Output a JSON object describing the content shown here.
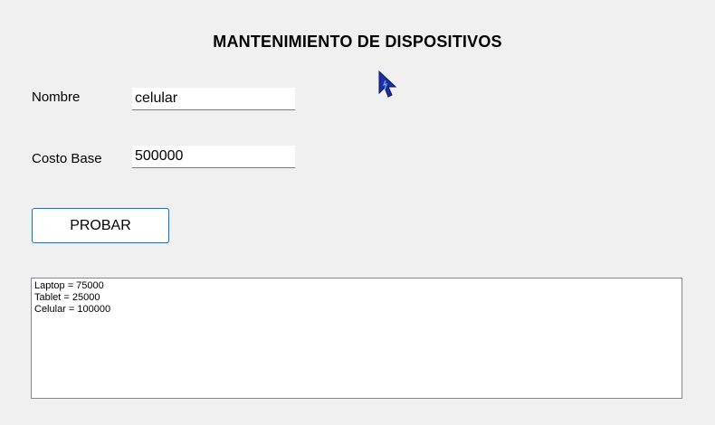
{
  "form": {
    "title": "MANTENIMIENTO DE DISPOSITIVOS",
    "nombre_label": "Nombre",
    "nombre_value": "celular",
    "costo_label": "Costo Base",
    "costo_value": "500000",
    "probar_label": "PROBAR",
    "output_lines": [
      "Laptop = 75000",
      "Tablet = 25000",
      "Celular = 100000"
    ]
  },
  "colors": {
    "background": "#f0f0f0",
    "button_border": "#0078d7",
    "cursor": "#1f2f9f"
  },
  "icons": {
    "cursor": "mouse-pointer-icon"
  }
}
